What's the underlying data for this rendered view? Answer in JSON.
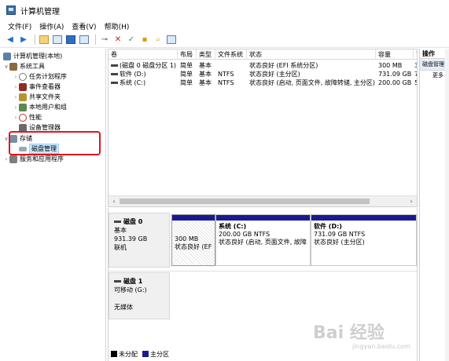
{
  "window": {
    "title": "计算机管理"
  },
  "menu": [
    "文件(F)",
    "操作(A)",
    "查看(V)",
    "帮助(H)"
  ],
  "tree": {
    "root": "计算机管理(本地)",
    "system_tools": "系统工具",
    "items": [
      "任务计划程序",
      "事件查看器",
      "共享文件夹",
      "本地用户和组",
      "性能",
      "设备管理器"
    ],
    "storage": "存储",
    "disk_mgmt": "磁盘管理",
    "services": "服务和应用程序"
  },
  "volumes": {
    "headers": [
      "卷",
      "布局",
      "类型",
      "文件系统",
      "状态",
      "容量",
      "可"
    ],
    "rows": [
      [
        "(磁盘 0 磁盘分区 1)",
        "简单",
        "基本",
        "",
        "状态良好 (EFI 系统分区)",
        "300 MB",
        "3"
      ],
      [
        "软件 (D:)",
        "简单",
        "基本",
        "NTFS",
        "状态良好 (主分区)",
        "731.09 GB",
        "7"
      ],
      [
        "系统 (C:)",
        "简单",
        "基本",
        "NTFS",
        "状态良好 (启动, 页面文件, 故障转储, 主分区)",
        "200.00 GB",
        "5"
      ]
    ]
  },
  "disks": [
    {
      "name": "磁盘 0",
      "type": "基本",
      "size": "931.39 GB",
      "status": "联机",
      "partitions": [
        {
          "title": "",
          "size": "300 MB",
          "status": "状态良好 (EF"
        },
        {
          "title": "系统 (C:)",
          "size": "200.00 GB NTFS",
          "status": "状态良好 (启动, 页面文件, 故障"
        },
        {
          "title": "软件 (D:)",
          "size": "731.09 GB NTFS",
          "status": "状态良好 (主分区)"
        }
      ]
    },
    {
      "name": "磁盘 1",
      "type": "可移动 (G:)",
      "status": "无媒体"
    }
  ],
  "legend": [
    "未分配",
    "主分区"
  ],
  "actions": {
    "header": "操作",
    "section": "磁盘管理",
    "more": "更多"
  },
  "colors": {
    "primary_partition": "#1a1a8f",
    "unallocated": "#000000",
    "highlight": "#e0141e"
  }
}
